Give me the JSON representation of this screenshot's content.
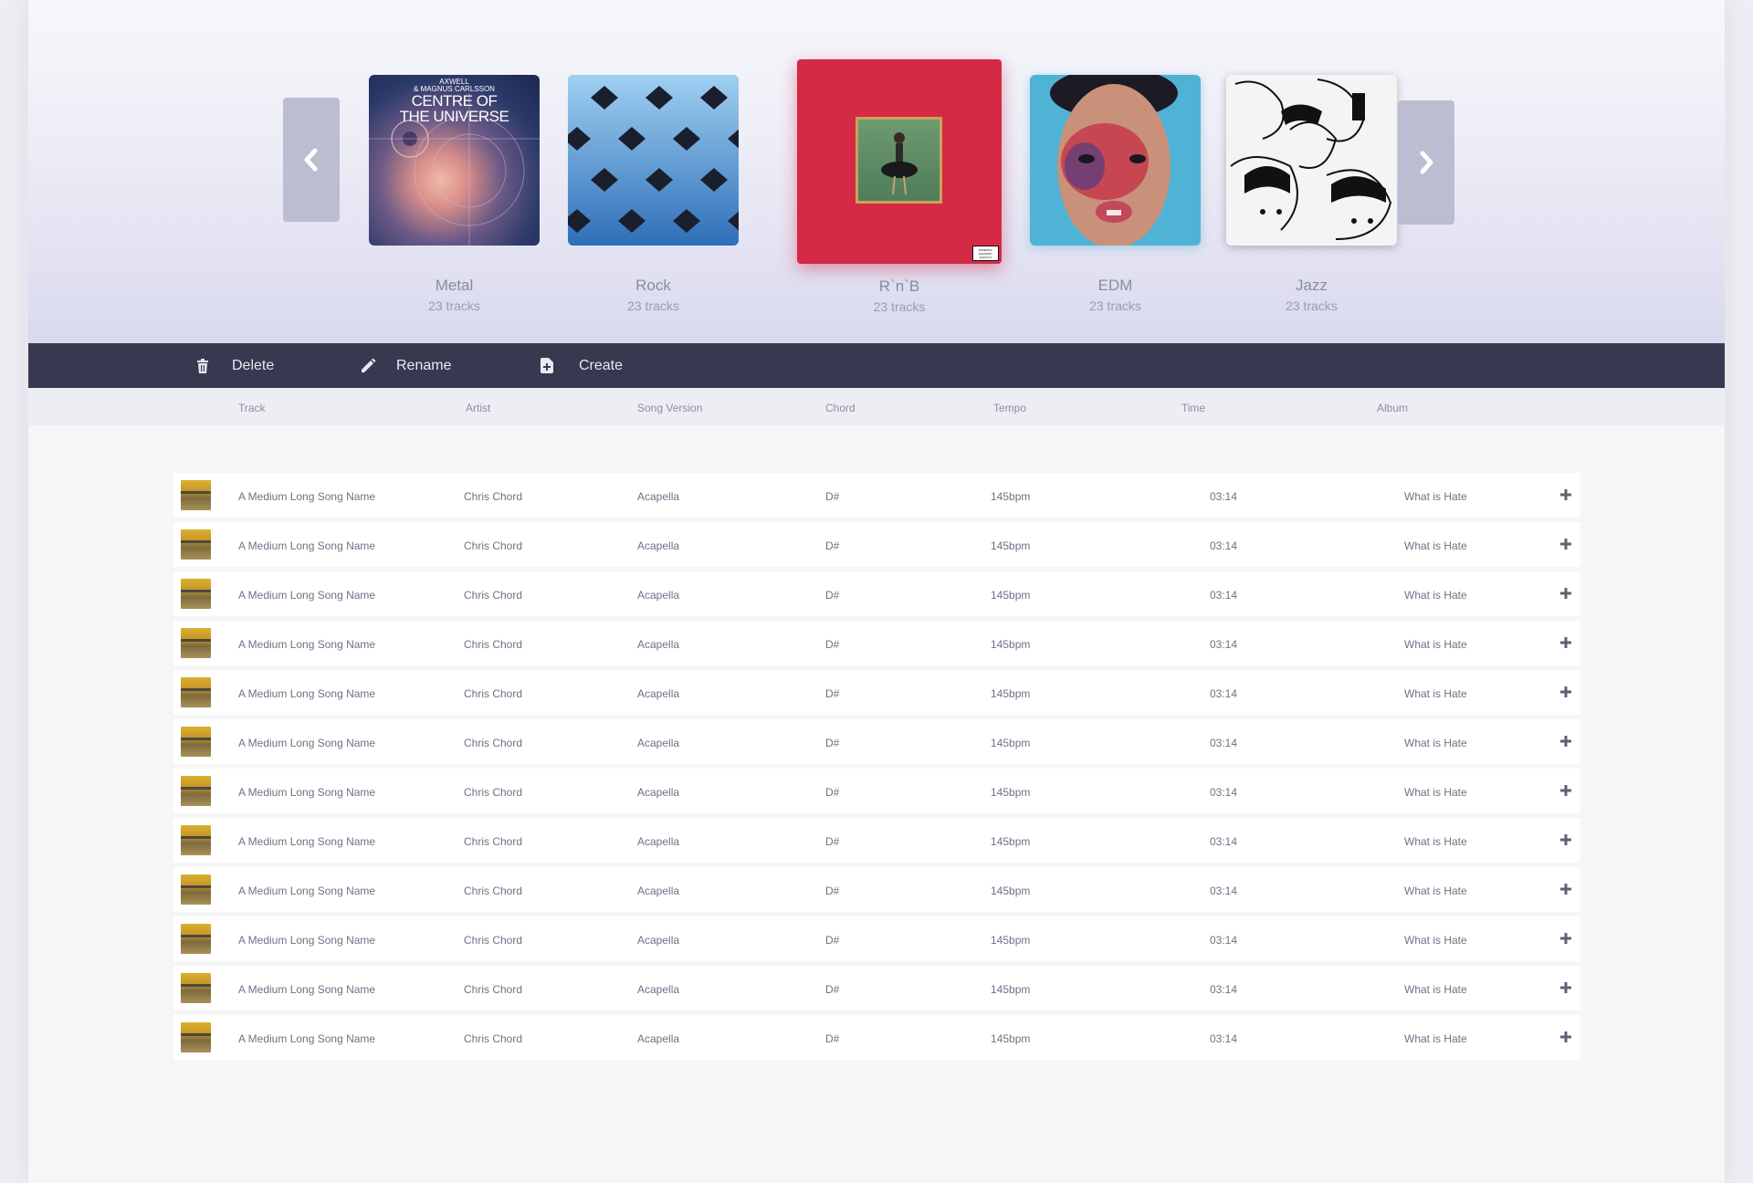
{
  "carousel": {
    "albums": [
      {
        "name": "Metal",
        "count": "23 tracks",
        "cover_text_1": "AXWELL",
        "cover_text_2": "& MAGNUS CARLSSON",
        "cover_text_3": "CENTRE OF",
        "cover_text_4": "THE UNIVERSE"
      },
      {
        "name": "Rock",
        "count": "23 tracks"
      },
      {
        "name": "R`n`B",
        "count": "23 tracks",
        "badge": "PARENTAL ADVISORY EXPLICIT CONTENT"
      },
      {
        "name": "EDM",
        "count": "23 tracks"
      },
      {
        "name": "Jazz",
        "count": "23 tracks"
      }
    ],
    "prev_icon": "chevron-left-icon",
    "next_icon": "chevron-right-icon"
  },
  "toolbar": {
    "delete_label": "Delete",
    "rename_label": "Rename",
    "create_label": "Create",
    "delete_icon": "trash-icon",
    "rename_icon": "pencil-icon",
    "create_icon": "new-document-icon"
  },
  "table": {
    "columns": [
      "Track",
      "Artist",
      "Song Version",
      "Chord",
      "Tempo",
      "Time",
      "Album"
    ],
    "rows": [
      {
        "track": "A Medium Long Song Name",
        "artist": "Chris Chord",
        "version": "Acapella",
        "chord": "D#",
        "tempo": "145bpm",
        "time": "03:14",
        "album": "What is Hate"
      },
      {
        "track": "A Medium Long Song Name",
        "artist": "Chris Chord",
        "version": "Acapella",
        "chord": "D#",
        "tempo": "145bpm",
        "time": "03:14",
        "album": "What is Hate"
      },
      {
        "track": "A Medium Long Song Name",
        "artist": "Chris Chord",
        "version": "Acapella",
        "chord": "D#",
        "tempo": "145bpm",
        "time": "03:14",
        "album": "What is Hate"
      },
      {
        "track": "A Medium Long Song Name",
        "artist": "Chris Chord",
        "version": "Acapella",
        "chord": "D#",
        "tempo": "145bpm",
        "time": "03:14",
        "album": "What is Hate"
      },
      {
        "track": "A Medium Long Song Name",
        "artist": "Chris Chord",
        "version": "Acapella",
        "chord": "D#",
        "tempo": "145bpm",
        "time": "03:14",
        "album": "What is Hate"
      },
      {
        "track": "A Medium Long Song Name",
        "artist": "Chris Chord",
        "version": "Acapella",
        "chord": "D#",
        "tempo": "145bpm",
        "time": "03:14",
        "album": "What is Hate"
      },
      {
        "track": "A Medium Long Song Name",
        "artist": "Chris Chord",
        "version": "Acapella",
        "chord": "D#",
        "tempo": "145bpm",
        "time": "03:14",
        "album": "What is Hate"
      },
      {
        "track": "A Medium Long Song Name",
        "artist": "Chris Chord",
        "version": "Acapella",
        "chord": "D#",
        "tempo": "145bpm",
        "time": "03:14",
        "album": "What is Hate"
      },
      {
        "track": "A Medium Long Song Name",
        "artist": "Chris Chord",
        "version": "Acapella",
        "chord": "D#",
        "tempo": "145bpm",
        "time": "03:14",
        "album": "What is Hate"
      },
      {
        "track": "A Medium Long Song Name",
        "artist": "Chris Chord",
        "version": "Acapella",
        "chord": "D#",
        "tempo": "145bpm",
        "time": "03:14",
        "album": "What is Hate"
      },
      {
        "track": "A Medium Long Song Name",
        "artist": "Chris Chord",
        "version": "Acapella",
        "chord": "D#",
        "tempo": "145bpm",
        "time": "03:14",
        "album": "What is Hate"
      },
      {
        "track": "A Medium Long Song Name",
        "artist": "Chris Chord",
        "version": "Acapella",
        "chord": "D#",
        "tempo": "145bpm",
        "time": "03:14",
        "album": "What is Hate"
      }
    ],
    "add_icon": "plus-icon"
  },
  "colors": {
    "toolbar_bg": "#373951",
    "accent_red": "#d42a45",
    "nav_button": "#bcbdd0"
  }
}
